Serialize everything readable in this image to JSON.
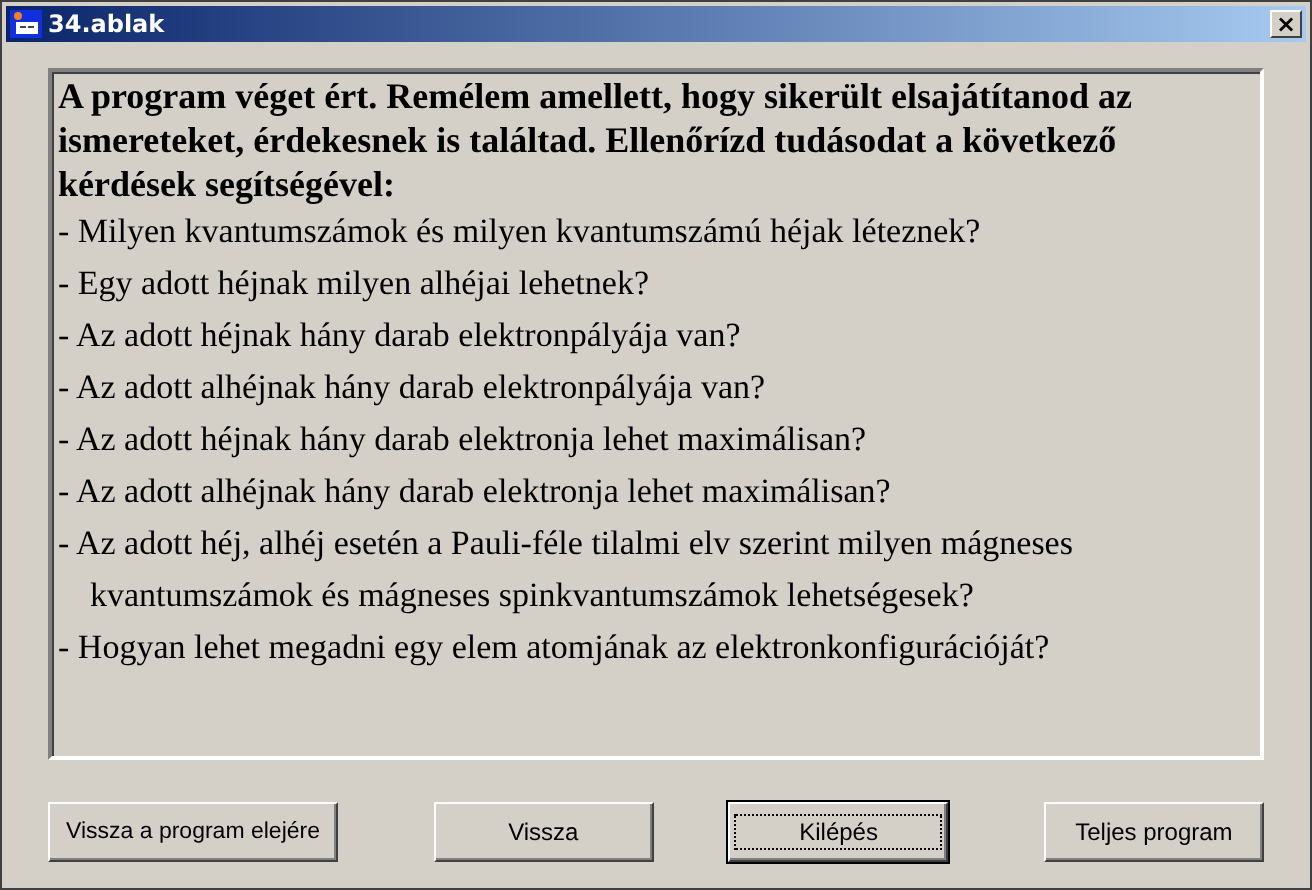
{
  "window": {
    "title": "34.ablak",
    "close": "×"
  },
  "intro": "A program véget ért. Remélem amellett, hogy sikerült elsajátítanod az ismereteket, érdekesnek is találtad. Ellenőrízd tudásodat a következő kérdések segítségével:",
  "questions": [
    {
      "lines": [
        "- Milyen kvantumszámok és milyen kvantumszámú héjak léteznek?"
      ]
    },
    {
      "lines": [
        "- Egy adott héjnak milyen alhéjai lehetnek?"
      ]
    },
    {
      "lines": [
        "- Az adott héjnak hány darab elektronpályája van?"
      ]
    },
    {
      "lines": [
        "- Az adott alhéjnak hány darab elektronpályája van?"
      ]
    },
    {
      "lines": [
        "- Az adott héjnak hány darab elektronja lehet maximálisan?"
      ]
    },
    {
      "lines": [
        "- Az adott alhéjnak hány darab elektronja lehet maximálisan?"
      ]
    },
    {
      "lines": [
        "- Az adott héj, alhéj esetén a Pauli-féle tilalmi elv szerint milyen mágneses",
        "kvantumszámok és mágneses spinkvantumszámok lehetségesek?"
      ]
    },
    {
      "lines": [
        "- Hogyan lehet megadni egy elem atomjának az elektronkonfigurációját?"
      ]
    }
  ],
  "buttons": [
    {
      "label": "Vissza a program elejére",
      "focused": false
    },
    {
      "label": "Vissza",
      "focused": false
    },
    {
      "label": "Kilépés",
      "focused": true
    },
    {
      "label": "Teljes program",
      "focused": false
    }
  ]
}
